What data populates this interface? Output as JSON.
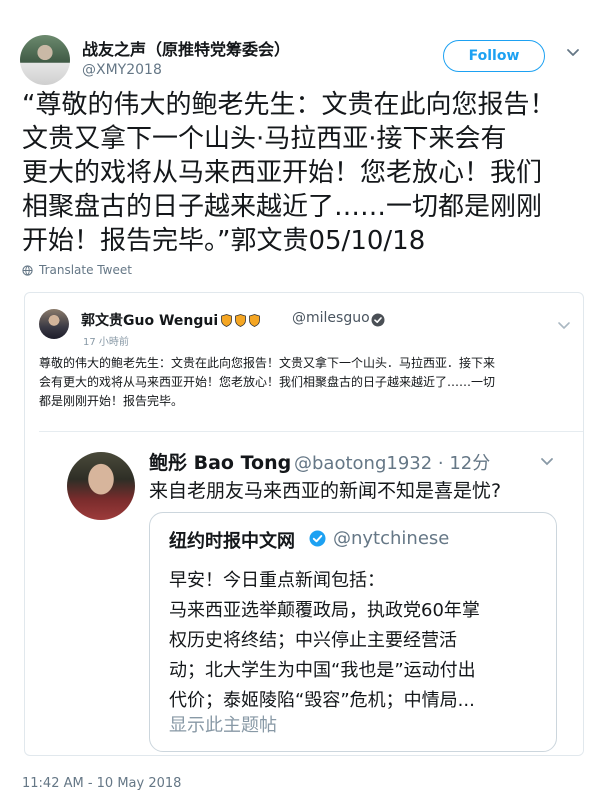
{
  "tweet": {
    "display_name": "战友之声（原推特党筹委会）",
    "handle": "@XMY2018",
    "follow_label": "Follow",
    "text": "“尊敬的伟大的鲍老先生：文贵在此向您报告！\n文贵又拿下一个山头·马拉西亚·接下来会有\n更大的戏将从马来西亚开始！您老放心！我们\n相聚盘古的日子越来越近了……一切都是刚刚\n开始！报告完毕。”郭文贵05/10/18",
    "translate_label": "Translate Tweet",
    "timestamp": "11:42 AM - 10 May 2018"
  },
  "embedded": {
    "author_name": "郭文贵Guo Wengui",
    "author_handle": "@milesguo",
    "time": "17 小時前",
    "text": "尊敬的伟大的鲍老先生：文贵在此向您报告！文贵又拿下一个山头．马拉西亚．接下来\n会有更大的戏将从马来西亚开始！您老放心！我们相聚盘古的日子越来越近了……一切\n都是刚刚开始！报告完毕。",
    "quoted": {
      "author_name": "鲍彤 Bao Tong",
      "author_handle": "@baotong1932 · 12分",
      "text": "来自老朋友马来西亚的新闻不知是喜是忧?",
      "nested": {
        "author_name": "纽约时报中文网",
        "author_handle": "@nytchinese",
        "text": "早安！今日重点新闻包括：\n马来西亚选举颠覆政局，执政党60年掌\n权历史将终结；中兴停止主要经营活\n动；北大学生为中国“我也是”运动付出\n代价；泰姬陵陷“毁容”危机；中情局...",
        "show_thread": "显示此主题帖"
      }
    }
  },
  "colors": {
    "accent": "#1da1f2",
    "secondary_text": "#657786",
    "shield": "#f5a623"
  },
  "icons": {
    "caret": "chevron-down-icon",
    "globe": "globe-icon",
    "verified": "verified-icon",
    "shield": "shield-icon"
  }
}
